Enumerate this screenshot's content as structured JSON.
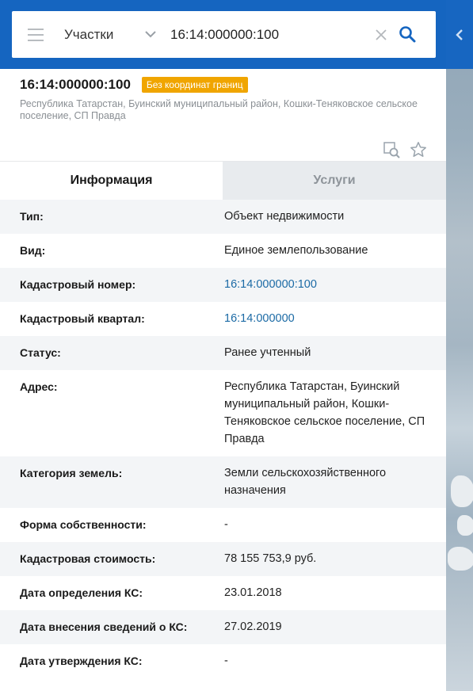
{
  "search": {
    "type_label": "Участки",
    "query": "16:14:000000:100"
  },
  "object": {
    "title": "16:14:000000:100",
    "badge": "Без координат границ",
    "address": "Республика Татарстан, Буинский муниципальный район, Кошки-Теняковское сельское поселение, СП Правда"
  },
  "tabs": {
    "info": "Информация",
    "services": "Услуги"
  },
  "rows": [
    {
      "label": "Тип:",
      "value": "Объект недвижимости"
    },
    {
      "label": "Вид:",
      "value": "Единое землепользование"
    },
    {
      "label": "Кадастровый номер:",
      "value": "16:14:000000:100"
    },
    {
      "label": "Кадастровый квартал:",
      "value": "16:14:000000"
    },
    {
      "label": "Статус:",
      "value": "Ранее учтенный"
    },
    {
      "label": "Адрес:",
      "value": "Республика Татарстан, Буинский муниципальный район, Кошки-Теняковское сельское поселение, СП Правда"
    },
    {
      "label": "Категория земель:",
      "value": "Земли сельскохозяйственного назначения"
    },
    {
      "label": "Форма собственности:",
      "value": "-"
    },
    {
      "label": "Кадастровая стоимость:",
      "value": "78 155 753,9 руб."
    },
    {
      "label": "Дата определения КС:",
      "value": "23.01.2018"
    },
    {
      "label": "Дата внесения сведений о КС:",
      "value": "27.02.2019"
    },
    {
      "label": "Дата утверждения КС:",
      "value": "-"
    }
  ],
  "colors": {
    "topbar": "#1565c0",
    "badge": "#f0a500",
    "link": "#1b6aa5"
  }
}
